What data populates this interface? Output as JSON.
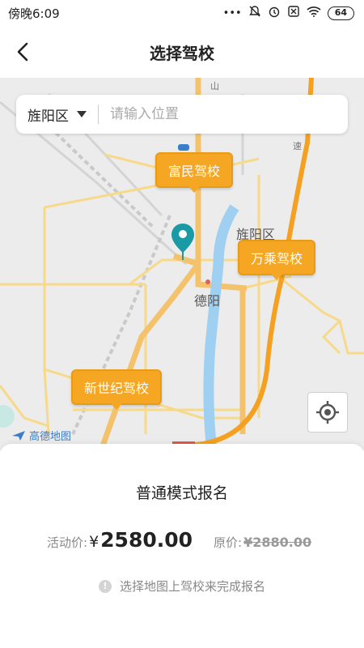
{
  "status_bar": {
    "time": "傍晚6:09",
    "icons": [
      "dots-icon",
      "mute-icon",
      "alarm-icon",
      "sim-icon",
      "wifi-icon"
    ],
    "battery": "64"
  },
  "header": {
    "title": "选择驾校",
    "back_icon": "chevron-left-icon"
  },
  "map": {
    "search": {
      "district": "旌阳区",
      "placeholder": "请输入位置"
    },
    "schools": [
      {
        "name": "富民驾校"
      },
      {
        "name": "万乘驾校"
      },
      {
        "name": "新世纪驾校"
      }
    ],
    "labels": {
      "district_label": "旌阳区",
      "city_label": "德阳"
    },
    "road_labels": {
      "highway_sign": "速",
      "road_number": "山"
    },
    "logo_text": "高德地图",
    "colors": {
      "marker": "#f5a623",
      "pin": "#1a9aa5",
      "river": "#9fd0f2",
      "highway": "#f5a020",
      "road": "#f7d98a"
    }
  },
  "sheet": {
    "title": "普通模式报名",
    "activity_label": "活动价:",
    "currency": "¥",
    "activity_price": "2580.00",
    "original_label": "原价:",
    "original_price": "¥2880.00",
    "hint": "选择地图上驾校来完成报名"
  }
}
